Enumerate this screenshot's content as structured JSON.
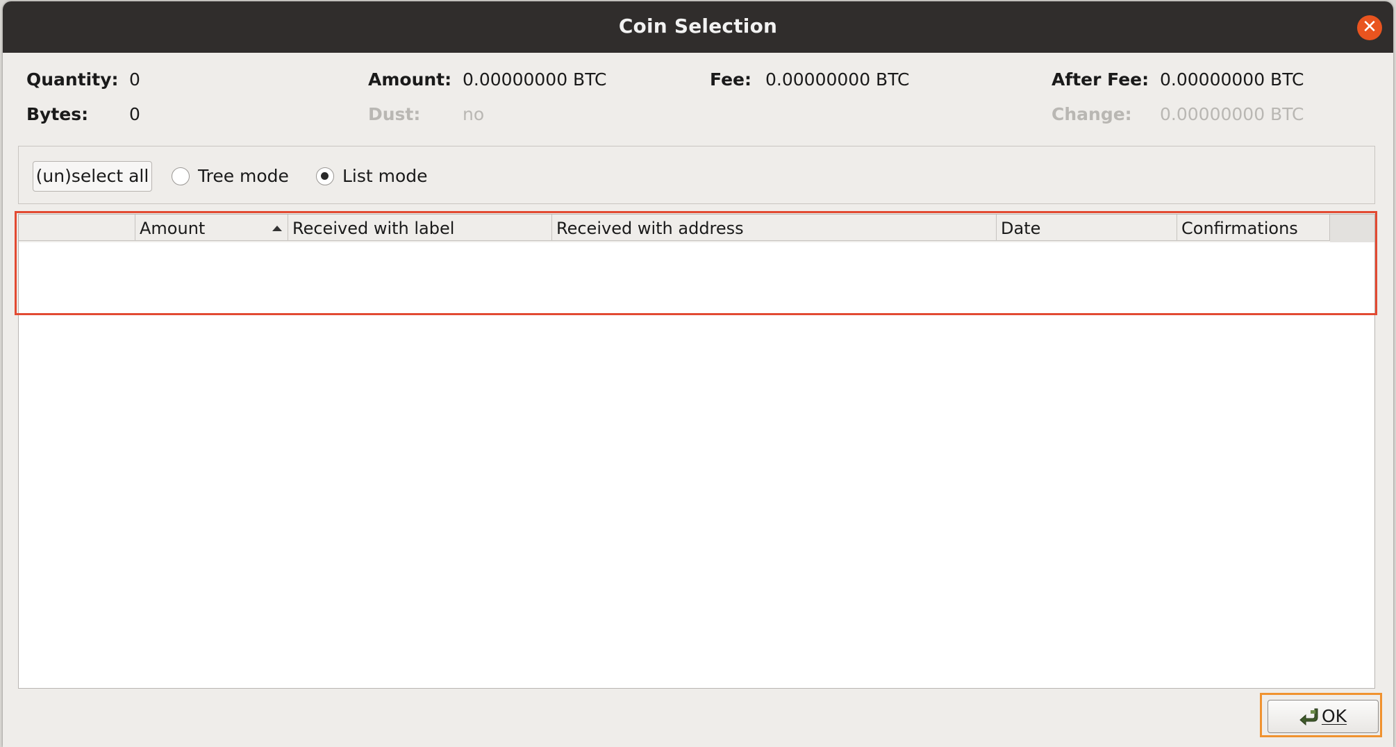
{
  "window": {
    "title": "Coin Selection"
  },
  "summary": {
    "quantity": {
      "label": "Quantity:",
      "value": "0"
    },
    "bytes": {
      "label": "Bytes:",
      "value": "0"
    },
    "amount": {
      "label": "Amount:",
      "value": "0.00000000 BTC"
    },
    "dust": {
      "label": "Dust:",
      "value": "no"
    },
    "fee": {
      "label": "Fee:",
      "value": "0.00000000 BTC"
    },
    "after_fee": {
      "label": "After Fee:",
      "value": "0.00000000 BTC"
    },
    "change": {
      "label": "Change:",
      "value": "0.00000000 BTC"
    }
  },
  "toolbar": {
    "unselect_all": "(un)select all",
    "tree_mode": "Tree mode",
    "list_mode": "List mode",
    "selected_mode": "List mode"
  },
  "table": {
    "columns": [
      "",
      "Amount",
      "Received with label",
      "Received with address",
      "Date",
      "Confirmations"
    ],
    "sort_column": "Amount",
    "sort_order": "ascending",
    "rows": []
  },
  "footer": {
    "ok_label": "OK"
  },
  "colors": {
    "titlebar": "#302d2c",
    "close_button": "#e9541f",
    "highlight_red": "#e24a32",
    "highlight_orange": "#f0922f"
  }
}
